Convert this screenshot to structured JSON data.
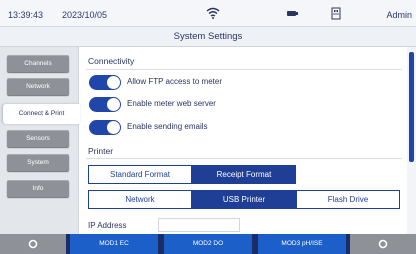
{
  "status_bar": {
    "time": "13:39:43",
    "date": "2023/10/05",
    "user": "Admin",
    "icons": [
      "wifi-icon",
      "battery-icon",
      "usb-icon"
    ]
  },
  "title": "System Settings",
  "sidebar": {
    "items": [
      {
        "label": "Channels",
        "active": false
      },
      {
        "label": "Network",
        "active": false
      },
      {
        "label": "Connect & Print",
        "active": true
      },
      {
        "label": "Sensors",
        "active": false
      },
      {
        "label": "System",
        "active": false
      },
      {
        "label": "Info",
        "active": false
      }
    ]
  },
  "connectivity": {
    "heading": "Connectivity",
    "toggles": [
      {
        "label": "Allow FTP access to meter",
        "on": true
      },
      {
        "label": "Enable meter web server",
        "on": true
      },
      {
        "label": "Enable sending emails",
        "on": true
      }
    ]
  },
  "printer": {
    "heading": "Printer",
    "format_options": [
      "Standard Format",
      "Receipt Format"
    ],
    "format_selected": "Receipt Format",
    "output_options": [
      "Network",
      "USB Printer",
      "Flash Drive"
    ],
    "output_selected": "USB Printer",
    "ip_label": "IP Address",
    "ip_value": ""
  },
  "bottom_bar": {
    "channels": [
      "MOD1 EC",
      "MOD2 DO",
      "MOD3 pH/ISE"
    ],
    "left_icon": "refresh-icon",
    "right_icon": "refresh-icon"
  },
  "colors": {
    "accent": "#1f46a8",
    "selected_segment": "#1f3f96",
    "bottom_bar": "#1a2d66",
    "channel_button": "#1d5fc9",
    "nav_inactive": "#8e9298"
  }
}
